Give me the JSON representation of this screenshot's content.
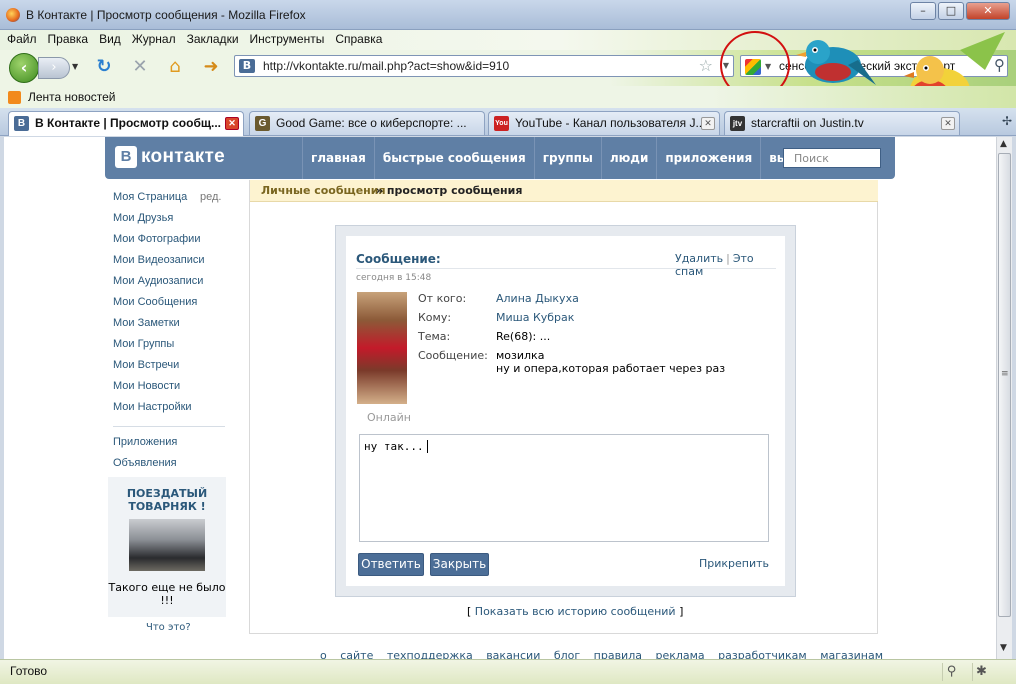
{
  "window": {
    "title": "В Контакте | Просмотр сообщения - Mozilla Firefox",
    "minimize": "–",
    "maximize": "□",
    "close": "✕"
  },
  "menubar": [
    "Файл",
    "Правка",
    "Вид",
    "Журнал",
    "Закладки",
    "Инструменты",
    "Справка"
  ],
  "navbar": {
    "url": "http://vkontakte.ru/mail.php?act=show&id=910",
    "search_query": "сенсорно-этический экстраверт",
    "favicon_letter": "В"
  },
  "bookmarks": {
    "item": "Лента новостей"
  },
  "tabs": [
    {
      "label": "В Контакте | Просмотр сообщ...",
      "icon": "vk-favicon",
      "icon_text": "В",
      "icon_color": "#4a6c96"
    },
    {
      "label": "Good Game: все о киберспорте: ...",
      "icon": "goodgame-favicon",
      "icon_text": "G",
      "icon_color": "#6b5a2e"
    },
    {
      "label": "YouTube - Канал пользователя J...",
      "icon": "youtube-favicon",
      "icon_text": "You",
      "icon_color": "#cc2222"
    },
    {
      "label": "starcraftii on Justin.tv",
      "icon": "justintv-favicon",
      "icon_text": "jtv",
      "icon_color": "#333333"
    }
  ],
  "vk": {
    "logo_letter": "В",
    "logo_text": "контакте",
    "nav": [
      "главная",
      "быстрые сообщения",
      "группы",
      "люди",
      "приложения",
      "выйти"
    ],
    "search_placeholder": "Поиск",
    "brand_color": "#5f7fa5"
  },
  "leftmenu": {
    "edit_label": "ред.",
    "items": [
      "Моя Страница",
      "Мои Друзья",
      "Мои Фотографии",
      "Мои Видеозаписи",
      "Мои Аудиозаписи",
      "Мои Сообщения",
      "Мои Заметки",
      "Мои Группы",
      "Мои Встречи",
      "Мои Новости",
      "Мои Настройки"
    ],
    "extra": [
      "Приложения",
      "Объявления"
    ],
    "promo_title": "ПОЕЗДАТЫЙ ТОВАРНЯК !",
    "promo_text": "Такого еще не было !!!",
    "whatis": "Что это?"
  },
  "breadcrumb": {
    "parent": "Личные сообщения",
    "current": "» просмотр сообщения"
  },
  "message": {
    "heading": "Сообщение:",
    "date": "сегодня в 15:48",
    "delete": "Удалить",
    "spam": "Это спам",
    "online": "Онлайн",
    "labels": {
      "from": "От кого:",
      "to": "Кому:",
      "subject": "Тема:",
      "body": "Сообщение:"
    },
    "from": "Алина Дыкуха",
    "to": "Миша Кубрак",
    "subject": "Re(68): ...",
    "body_line1": "мозилка",
    "body_line2": "ну и опера,которая работает через раз",
    "reply_text": "ну так...",
    "reply_button": "Ответить",
    "close_button": "Закрыть",
    "attach": "Прикрепить"
  },
  "history_link": "Показать всю историю сообщений",
  "footer": "о сайте техподдержка вакансии блог правила реклама разработчикам магазинам",
  "status": {
    "text": "Готово"
  }
}
